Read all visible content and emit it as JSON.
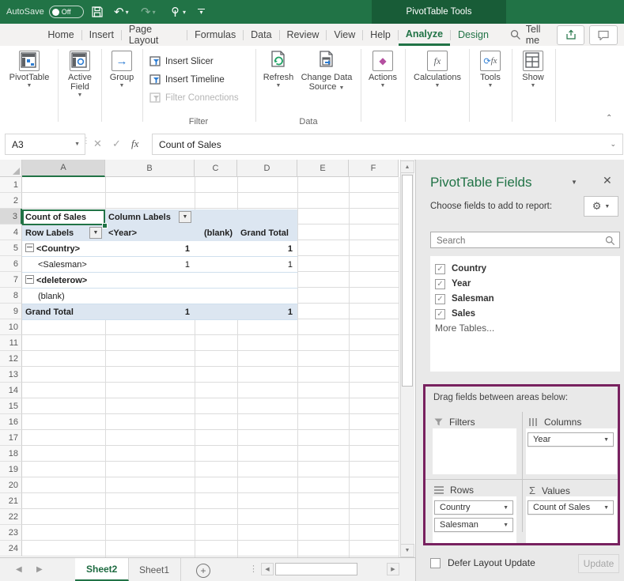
{
  "titlebar": {
    "autosave_label": "AutoSave",
    "autosave_state": "Off",
    "contextual_tab": "PivotTable Tools"
  },
  "ribbon_tabs": {
    "items": [
      {
        "label": "Home"
      },
      {
        "label": "Insert"
      },
      {
        "label": "Page Layout"
      },
      {
        "label": "Formulas"
      },
      {
        "label": "Data"
      },
      {
        "label": "Review"
      },
      {
        "label": "View"
      },
      {
        "label": "Help"
      },
      {
        "label": "Analyze",
        "active": true
      },
      {
        "label": "Design",
        "green": true
      }
    ],
    "tell_me": "Tell me"
  },
  "ribbon": {
    "pivottable": "PivotTable",
    "active_field": "Active Field",
    "group": "Group",
    "insert_slicer": "Insert Slicer",
    "insert_timeline": "Insert Timeline",
    "filter_connections": "Filter Connections",
    "filter_group_label": "Filter",
    "refresh": "Refresh",
    "change_data_source_line1": "Change Data",
    "change_data_source_line2": "Source",
    "data_group_label": "Data",
    "actions": "Actions",
    "calculations": "Calculations",
    "tools": "Tools",
    "show": "Show"
  },
  "formula_bar": {
    "name_box": "A3",
    "content": "Count of Sales"
  },
  "grid": {
    "columns": [
      "A",
      "B",
      "C",
      "D",
      "E",
      "F"
    ],
    "row_count": 24,
    "selected_cell": "A3",
    "selected_column_index": 0,
    "selected_row": 3,
    "pivot_cells": [
      {
        "r": 3,
        "c": 0,
        "text": "Count of Sales",
        "bold": true,
        "selected": true
      },
      {
        "r": 3,
        "c": 1,
        "text": "Column Labels",
        "bold": true,
        "dropdown": true
      },
      {
        "r": 4,
        "c": 0,
        "text": "Row Labels",
        "bold": true,
        "dropdown": true
      },
      {
        "r": 4,
        "c": 1,
        "text": "<Year>",
        "bold": true
      },
      {
        "r": 4,
        "c": 2,
        "text": "(blank)",
        "bold": true,
        "align": "right"
      },
      {
        "r": 4,
        "c": 3,
        "text": "Grand Total",
        "bold": true
      },
      {
        "r": 5,
        "c": 0,
        "text": "<Country>",
        "bold": true,
        "expand": true
      },
      {
        "r": 5,
        "c": 1,
        "text": "1",
        "bold": true,
        "align": "right"
      },
      {
        "r": 5,
        "c": 3,
        "text": "1",
        "bold": true,
        "align": "right"
      },
      {
        "r": 6,
        "c": 0,
        "text": "<Salesman>",
        "indent": true
      },
      {
        "r": 6,
        "c": 1,
        "text": "1",
        "align": "right"
      },
      {
        "r": 6,
        "c": 3,
        "text": "1",
        "align": "right"
      },
      {
        "r": 7,
        "c": 0,
        "text": "<deleterow>",
        "bold": true,
        "expand": true
      },
      {
        "r": 8,
        "c": 0,
        "text": "(blank)",
        "indent": true
      },
      {
        "r": 9,
        "c": 0,
        "text": "Grand Total",
        "bold": true
      },
      {
        "r": 9,
        "c": 1,
        "text": "1",
        "bold": true,
        "align": "right"
      },
      {
        "r": 9,
        "c": 3,
        "text": "1",
        "bold": true,
        "align": "right"
      }
    ]
  },
  "sheet_bar": {
    "tabs": [
      {
        "label": "Sheet2",
        "active": true
      },
      {
        "label": "Sheet1"
      }
    ]
  },
  "panel": {
    "title": "PivotTable Fields",
    "choose_label": "Choose fields to add to report:",
    "search_placeholder": "Search",
    "fields": [
      {
        "label": "Country",
        "checked": true
      },
      {
        "label": "Year",
        "checked": true
      },
      {
        "label": "Salesman",
        "checked": true
      },
      {
        "label": "Sales",
        "checked": true
      }
    ],
    "more_tables": "More Tables...",
    "drag_label": "Drag fields between areas below:",
    "areas": {
      "filters": {
        "label": "Filters",
        "pills": []
      },
      "columns": {
        "label": "Columns",
        "pills": [
          "Year"
        ]
      },
      "rows": {
        "label": "Rows",
        "pills": [
          "Country",
          "Salesman"
        ]
      },
      "values": {
        "label": "Values",
        "pills": [
          "Count of Sales"
        ]
      }
    },
    "defer_label": "Defer Layout Update",
    "update_label": "Update"
  },
  "colors": {
    "excel_green": "#217346",
    "contextual_green": "#185c37",
    "pivot_header_blue": "#dce6f1",
    "pivot_border_blue": "#cfe0ee",
    "accent_purple": "#78215f"
  }
}
